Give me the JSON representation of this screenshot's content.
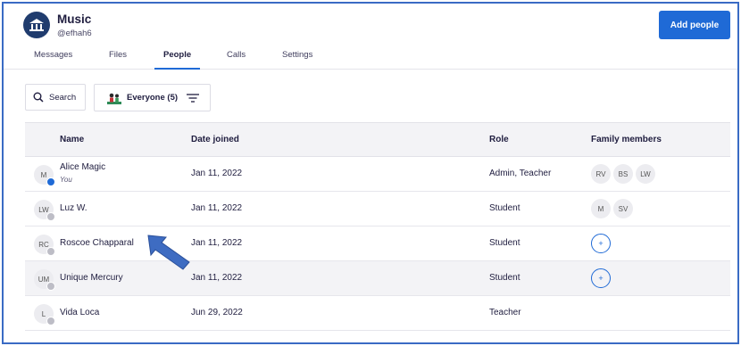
{
  "class": {
    "name": "Music",
    "code": "@efhah6"
  },
  "header": {
    "add_people_label": "Add people"
  },
  "tabs": [
    {
      "label": "Messages"
    },
    {
      "label": "Files"
    },
    {
      "label": "People"
    },
    {
      "label": "Calls"
    },
    {
      "label": "Settings"
    }
  ],
  "active_tab": "People",
  "toolbar": {
    "search_label": "Search",
    "filter_label": "Everyone (5)"
  },
  "table": {
    "headers": {
      "name": "Name",
      "date": "Date joined",
      "role": "Role",
      "family": "Family members"
    },
    "rows": [
      {
        "initials": "M",
        "name": "Alice Magic",
        "sub": "You",
        "date": "Jan 11, 2022",
        "role": "Admin, Teacher",
        "family": [
          "RV",
          "BS",
          "LW"
        ]
      },
      {
        "initials": "LW",
        "name": "Luz W.",
        "sub": "",
        "date": "Jan 11, 2022",
        "role": "Student",
        "family": [
          "M",
          "SV"
        ]
      },
      {
        "initials": "RC",
        "name": "Roscoe Chapparal",
        "sub": "",
        "date": "Jan 11, 2022",
        "role": "Student",
        "family": []
      },
      {
        "initials": "UM",
        "name": "Unique Mercury",
        "sub": "",
        "date": "Jan 11, 2022",
        "role": "Student",
        "family": []
      },
      {
        "initials": "L",
        "name": "Vida Loca",
        "sub": "",
        "date": "Jun 29, 2022",
        "role": "Teacher",
        "family": []
      }
    ]
  },
  "add_family_symbol": "+",
  "colors": {
    "accent": "#1f6ad6",
    "class_avatar": "#203c6e",
    "annotation_arrow": "#3e6cc2"
  }
}
